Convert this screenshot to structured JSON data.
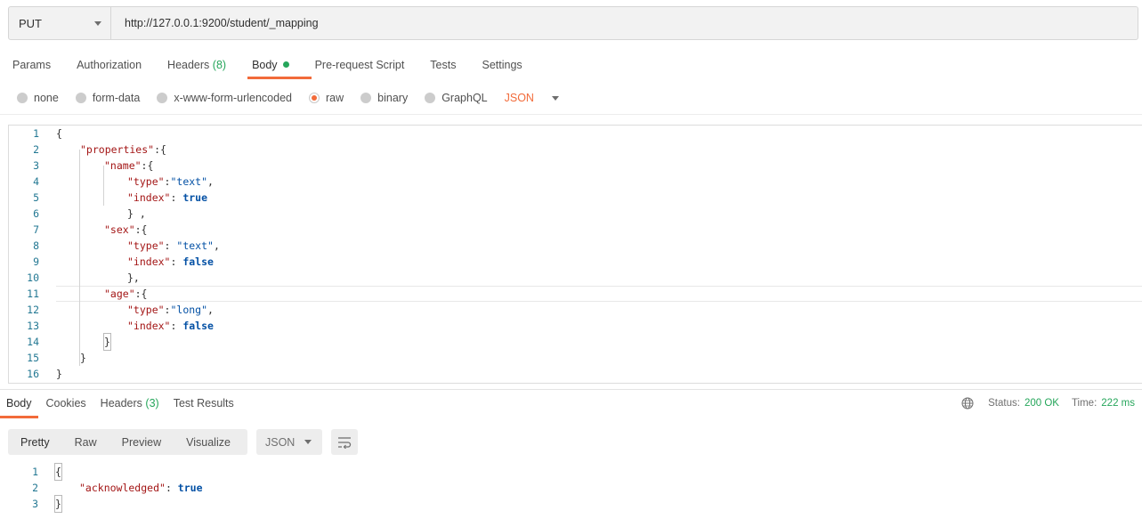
{
  "request": {
    "method": "PUT",
    "url": "http://127.0.0.1:9200/student/_mapping"
  },
  "request_tabs": [
    {
      "label": "Params"
    },
    {
      "label": "Authorization"
    },
    {
      "label": "Headers",
      "count": "(8)"
    },
    {
      "label": "Body",
      "active": true
    },
    {
      "label": "Pre-request Script"
    },
    {
      "label": "Tests"
    },
    {
      "label": "Settings"
    }
  ],
  "body_types": {
    "none": "none",
    "form_data": "form-data",
    "urlencoded": "x-www-form-urlencoded",
    "raw": "raw",
    "binary": "binary",
    "graphql": "GraphQL",
    "selected": "raw",
    "language": "JSON"
  },
  "editor": {
    "line_numbers": [
      "1",
      "2",
      "3",
      "4",
      "5",
      "6",
      "7",
      "8",
      "9",
      "10",
      "11",
      "12",
      "13",
      "14",
      "15",
      "16"
    ],
    "lines": [
      "{",
      "\"properties\":{",
      "\"name\":{",
      "\"type\":\"text\",",
      "\"index\": true",
      "} ,",
      "\"sex\":{",
      "\"type\": \"text\",",
      "\"index\": false",
      "},",
      "\"age\":{",
      "\"type\":\"long\",",
      "\"index\": false",
      "}",
      "}",
      "}"
    ]
  },
  "response_tabs": [
    {
      "label": "Body",
      "active": true
    },
    {
      "label": "Cookies"
    },
    {
      "label": "Headers",
      "count": "(3)"
    },
    {
      "label": "Test Results"
    }
  ],
  "status": {
    "status_label": "Status:",
    "status_value": "200 OK",
    "time_label": "Time:",
    "time_value": "222 ms"
  },
  "response_toolbar": {
    "views": [
      "Pretty",
      "Raw",
      "Preview",
      "Visualize"
    ],
    "active_view": "Pretty",
    "format": "JSON"
  },
  "response": {
    "line_numbers": [
      "1",
      "2",
      "3"
    ],
    "lines": [
      "{",
      "\"acknowledged\": true",
      "}"
    ]
  },
  "colors": {
    "accent": "#f26b3a",
    "success": "#26a65b",
    "json_key": "#a31515",
    "json_value": "#0451a5",
    "line_number": "#237893"
  },
  "icons": {
    "method_dropdown": "chevron-down-icon",
    "status_globe": "globe-icon",
    "wrap": "wrap-lines-icon"
  }
}
